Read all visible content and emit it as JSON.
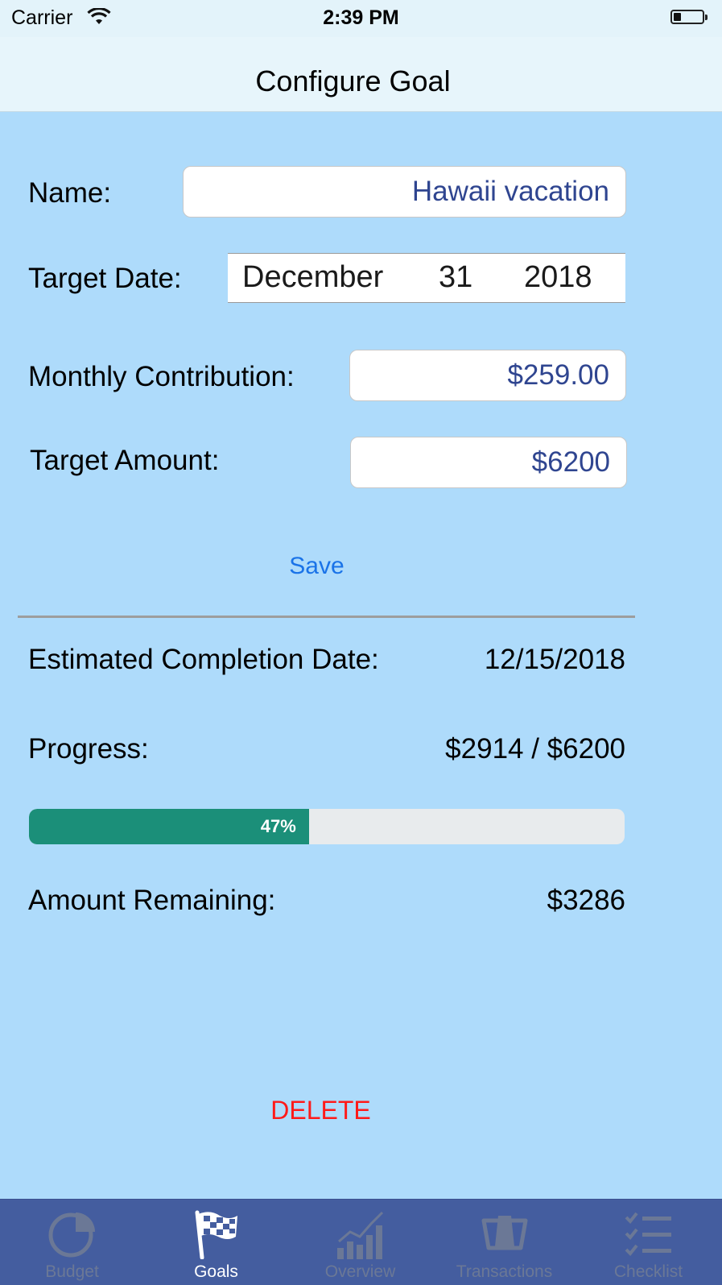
{
  "status_bar": {
    "carrier": "Carrier",
    "time": "2:39 PM"
  },
  "nav": {
    "title": "Configure Goal"
  },
  "form": {
    "name_label": "Name:",
    "name_value": "Hawaii vacation",
    "target_date_label": "Target Date:",
    "target_date": {
      "month": "December",
      "day": "31",
      "year": "2018"
    },
    "monthly_label": "Monthly Contribution:",
    "monthly_value": "$259.00",
    "target_amount_label": "Target Amount:",
    "target_amount_value": "$6200",
    "save_label": "Save"
  },
  "summary": {
    "completion_label": "Estimated Completion Date:",
    "completion_value": "12/15/2018",
    "progress_label": "Progress:",
    "progress_value": "$2914 / $6200",
    "progress_percent_text": "47%",
    "progress_fraction": 0.47,
    "remaining_label": "Amount Remaining:",
    "remaining_value": "$3286"
  },
  "delete_label": "DELETE",
  "colors": {
    "background": "#aedbfb",
    "progress_fill": "#1b8f79",
    "save": "#1a73e8",
    "delete": "#ff1a1a",
    "tabbar": "#445d9f"
  },
  "tabs": [
    {
      "label": "Budget",
      "icon": "pie-chart-icon",
      "active": false
    },
    {
      "label": "Goals",
      "icon": "checkered-flag-icon",
      "active": true
    },
    {
      "label": "Overview",
      "icon": "bar-chart-icon",
      "active": false
    },
    {
      "label": "Transactions",
      "icon": "receipt-icon",
      "active": false
    },
    {
      "label": "Checklist",
      "icon": "checklist-icon",
      "active": false
    }
  ]
}
